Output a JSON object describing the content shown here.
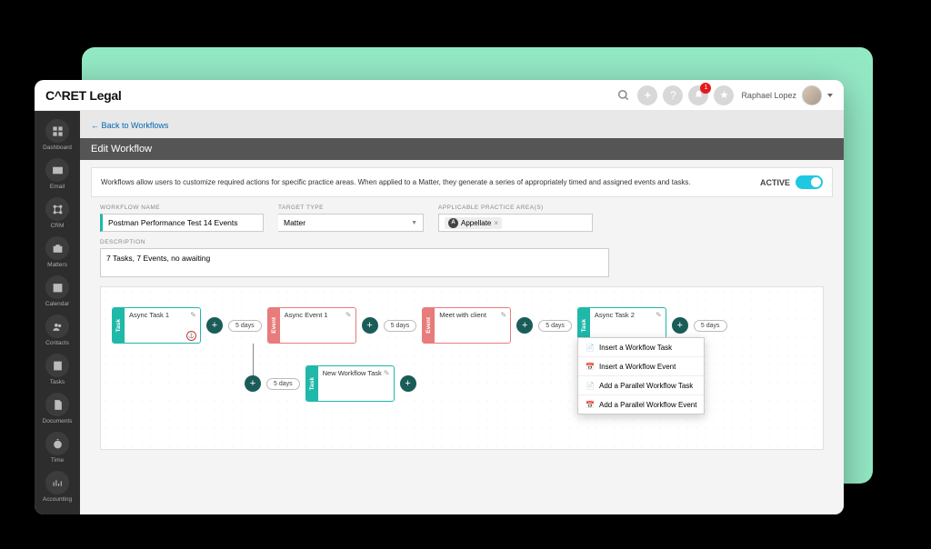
{
  "brand": "C^RET Legal",
  "user": {
    "name": "Raphael Lopez",
    "notifications": "1"
  },
  "sidebar": [
    {
      "label": "Dashboard"
    },
    {
      "label": "Email"
    },
    {
      "label": "CRM"
    },
    {
      "label": "Matters"
    },
    {
      "label": "Calendar"
    },
    {
      "label": "Contacts"
    },
    {
      "label": "Tasks"
    },
    {
      "label": "Documents"
    },
    {
      "label": "Time"
    },
    {
      "label": "Accounting"
    }
  ],
  "back_link": "Back to Workflows",
  "page_title": "Edit Workflow",
  "intro": "Workflows allow users to customize required actions for specific practice areas. When applied to a Matter, they generate a series of appropriately timed and assigned events and tasks.",
  "active_label": "ACTIVE",
  "fields": {
    "name_label": "WORKFLOW NAME",
    "name_value": "Postman Performance Test  14 Events",
    "target_label": "TARGET TYPE",
    "target_value": "Matter",
    "area_label": "APPLICABLE PRACTICE AREA(S)",
    "area_chip": "Appellate",
    "desc_label": "DESCRIPTION",
    "desc_value": "7 Tasks, 7 Events, no awaiting"
  },
  "nodes": {
    "n1": "Async Task 1",
    "n2": "Async Event 1",
    "n3": "Meet with client",
    "n4": "Async Task 2",
    "n5": "New Workflow Task",
    "type_task": "Task",
    "type_event": "Event"
  },
  "duration": "5 days",
  "menu": {
    "i1": "Insert a Workflow Task",
    "i2": "Insert a Workflow Event",
    "i3": "Add a Parallel Workflow Task",
    "i4": "Add a Parallel Workflow Event"
  }
}
